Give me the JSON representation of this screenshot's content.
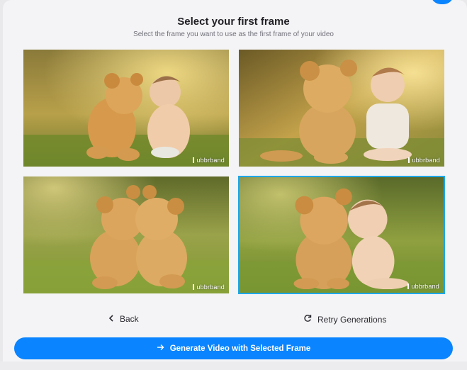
{
  "dialog": {
    "title": "Select your first frame",
    "subtitle": "Select the frame you want to use as the first frame of your video"
  },
  "frames": [
    {
      "watermark": "ubbrband",
      "selected": false
    },
    {
      "watermark": "ubbrband",
      "selected": false
    },
    {
      "watermark": "ubbrband",
      "selected": false
    },
    {
      "watermark": "ubbrband",
      "selected": true
    }
  ],
  "actions": {
    "back_label": "Back",
    "retry_label": "Retry Generations",
    "generate_label": "Generate Video with Selected Frame"
  },
  "icons": {
    "back": "chevron-left-icon",
    "retry": "refresh-icon",
    "generate": "arrow-right-icon"
  },
  "colors": {
    "accent": "#0a84ff",
    "selected_border": "#1ea7e7"
  }
}
